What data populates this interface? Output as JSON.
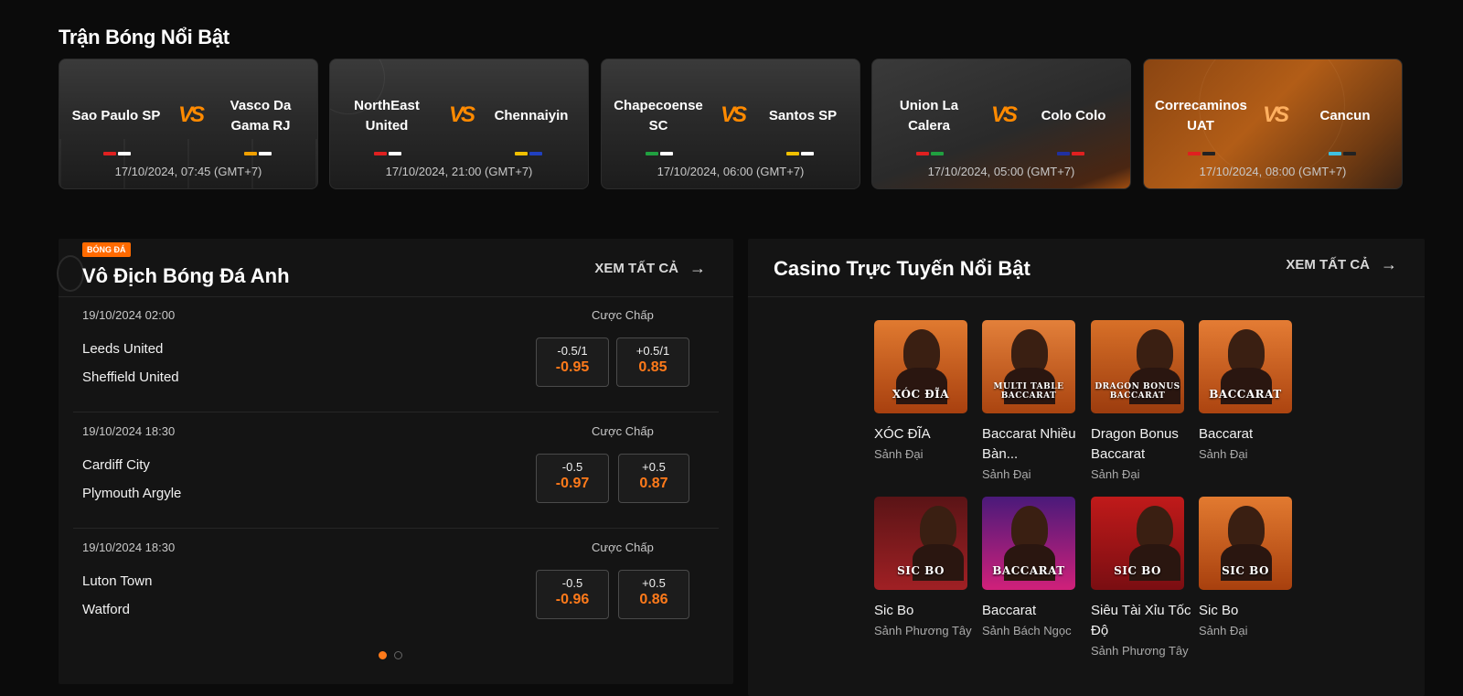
{
  "featured": {
    "title": "Trận Bóng Nổi Bật",
    "vs_text": "VS",
    "matches": [
      {
        "home": "Sao Paulo SP",
        "away": "Vasco Da Gama RJ",
        "time": "17/10/2024, 07:45 (GMT+7)",
        "home_colors": [
          "#e02020",
          "#ffffff"
        ],
        "away_colors": [
          "#f0a000",
          "#ffffff"
        ]
      },
      {
        "home": "NorthEast United",
        "away": "Chennaiyin",
        "time": "17/10/2024, 21:00 (GMT+7)",
        "home_colors": [
          "#e02020",
          "#ffffff"
        ],
        "away_colors": [
          "#f0c000",
          "#2040c0"
        ]
      },
      {
        "home": "Chapecoense SC",
        "away": "Santos SP",
        "time": "17/10/2024, 06:00 (GMT+7)",
        "home_colors": [
          "#20a040",
          "#ffffff"
        ],
        "away_colors": [
          "#f0c000",
          "#ffffff"
        ]
      },
      {
        "home": "Union La Calera",
        "away": "Colo Colo",
        "time": "17/10/2024, 05:00 (GMT+7)",
        "home_colors": [
          "#e02020",
          "#20a040"
        ],
        "away_colors": [
          "#2030a0",
          "#e02020"
        ]
      },
      {
        "home": "Correcaminos UAT",
        "away": "Cancun",
        "time": "17/10/2024, 08:00 (GMT+7)",
        "home_colors": [
          "#e02020",
          "#222222"
        ],
        "away_colors": [
          "#40c0e0",
          "#222222"
        ]
      }
    ]
  },
  "league": {
    "badge": "BÓNG ĐÁ",
    "title": "Vô Địch Bóng Đá Anh",
    "see_all": "XEM TẤT CẢ",
    "matches": [
      {
        "date": "19/10/2024 02:00",
        "type": "Cược Chấp",
        "home": "Leeds United",
        "away": "Sheffield United",
        "odds": [
          {
            "hc": "-0.5/1",
            "price": "-0.95"
          },
          {
            "hc": "+0.5/1",
            "price": "0.85"
          }
        ]
      },
      {
        "date": "19/10/2024 18:30",
        "type": "Cược Chấp",
        "home": "Cardiff City",
        "away": "Plymouth Argyle",
        "odds": [
          {
            "hc": "-0.5",
            "price": "-0.97"
          },
          {
            "hc": "+0.5",
            "price": "0.87"
          }
        ]
      },
      {
        "date": "19/10/2024 18:30",
        "type": "Cược Chấp",
        "home": "Luton Town",
        "away": "Watford",
        "odds": [
          {
            "hc": "-0.5",
            "price": "-0.96"
          },
          {
            "hc": "+0.5",
            "price": "0.86"
          }
        ]
      }
    ]
  },
  "casino": {
    "title": "Casino Trực Tuyến Nổi Bật",
    "see_all": "XEM TẤT CẢ",
    "games": [
      {
        "name": "XÓC ĐĨA",
        "lobby": "Sảnh Đại",
        "brand": "XÓC ĐĨA",
        "bg": "#c4561a"
      },
      {
        "name": "Baccarat Nhiều Bàn...",
        "lobby": "Sảnh Đại",
        "brand": "MULTI TABLE BACCARAT",
        "bg": "#c65a1c"
      },
      {
        "name": "Dragon Bonus Baccarat",
        "lobby": "Sảnh Đại",
        "brand": "DRAGON BONUS BACCARAT",
        "bg": "#b8501a"
      },
      {
        "name": "Baccarat",
        "lobby": "Sảnh Đại",
        "brand": "BACCARAT",
        "bg": "#c8561c"
      },
      {
        "name": "Sic Bo",
        "lobby": "Sảnh Phương Tây",
        "brand": "SIC BO",
        "bg": "#8a1a1e"
      },
      {
        "name": "Baccarat",
        "lobby": "Sảnh Bách Ngọc",
        "brand": "BACCARAT",
        "bg": "#b0208a"
      },
      {
        "name": "Siêu Tài Xỉu Tốc Độ",
        "lobby": "Sảnh Phương Tây",
        "brand": "SIC BO",
        "bg": "#b01818"
      },
      {
        "name": "Sic Bo",
        "lobby": "Sảnh Đại",
        "brand": "SIC BO",
        "bg": "#c65418"
      }
    ]
  }
}
